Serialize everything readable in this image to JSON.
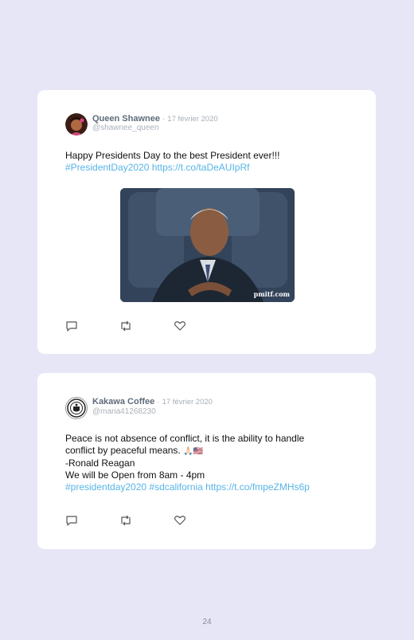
{
  "tweets": [
    {
      "author": "Queen Shawnee",
      "separator": "·",
      "date": "17 février 2020",
      "handle": "@shawnee_queen",
      "lines": [
        "Happy Presidents Day to the best President ever!!!"
      ],
      "links": "#PresidentDay2020 https://t.co/taDeAUIpRf",
      "media_watermark": "pmitf.com"
    },
    {
      "author": "Kakawa Coffee",
      "separator": "·",
      "date": "17 février 2020",
      "handle": "@maria41268230",
      "lines": [
        "Peace is not absence of conflict, it is the ability to handle",
        "conflict by peaceful means.",
        "-Ronald Reagan",
        "We will be Open from 8am - 4pm"
      ],
      "emoji": "🙏🏻🇺🇸",
      "links": "#presidentday2020 #sdcalifornia https://t.co/fmpeZMHs6p"
    }
  ],
  "page_number": "24",
  "icons": [
    "reply-icon",
    "retweet-icon",
    "like-icon"
  ],
  "colors": {
    "background": "#e6e6f7",
    "link": "#57b4e6",
    "author": "#5e6b7a"
  }
}
